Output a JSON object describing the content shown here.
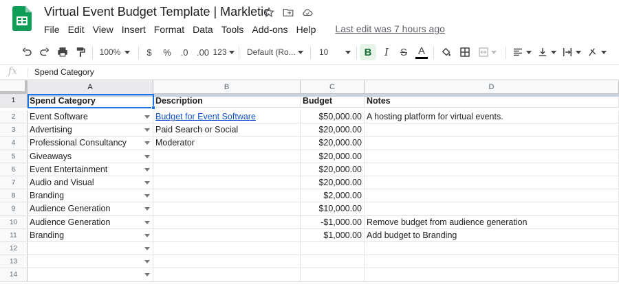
{
  "doc": {
    "title": "Virtual Event Budget Template | Markletic",
    "menus": [
      "File",
      "Edit",
      "View",
      "Insert",
      "Format",
      "Data",
      "Tools",
      "Add-ons",
      "Help"
    ],
    "last_edit": "Last edit was 7 hours ago"
  },
  "toolbar": {
    "zoom": "100%",
    "currency": "$",
    "percent": "%",
    "decrease_decimals": ".0",
    "increase_decimals": ".00",
    "more_formats": "123",
    "font": "Default (Ro...",
    "font_size": "10",
    "bold": "B",
    "italic": "I",
    "strike": "S",
    "text_color": "A"
  },
  "formula_bar": {
    "fx_label": "fx",
    "value": "Spend Category"
  },
  "columns": [
    "A",
    "B",
    "C",
    "D"
  ],
  "header_row": {
    "spend_category": "Spend Category",
    "description": "Description",
    "budget": "Budget",
    "notes": "Notes"
  },
  "rows": [
    {
      "num": "1"
    },
    {
      "num": "2",
      "category": "Event Software",
      "description": "Budget for Event Software",
      "budget": "$50,000.00",
      "notes": "A hosting platform for virtual events."
    },
    {
      "num": "3",
      "category": "Advertising",
      "description": "Paid Search or Social",
      "budget": "$20,000.00",
      "notes": ""
    },
    {
      "num": "4",
      "category": "Professional Consultancy",
      "description": "Moderator",
      "budget": "$20,000.00",
      "notes": ""
    },
    {
      "num": "5",
      "category": "Giveaways",
      "description": "",
      "budget": "$20,000.00",
      "notes": ""
    },
    {
      "num": "6",
      "category": "Event Entertainment",
      "description": "",
      "budget": "$20,000.00",
      "notes": ""
    },
    {
      "num": "7",
      "category": "Audio and Visual",
      "description": "",
      "budget": "$20,000.00",
      "notes": ""
    },
    {
      "num": "8",
      "category": "Branding",
      "description": "",
      "budget": "$2,000.00",
      "notes": ""
    },
    {
      "num": "9",
      "category": "Audience Generation",
      "description": "",
      "budget": "$10,000.00",
      "notes": ""
    },
    {
      "num": "10",
      "category": "Audience Generation",
      "description": "",
      "budget": "-$1,000.00",
      "notes": "Remove budget from audience generation"
    },
    {
      "num": "11",
      "category": "Branding",
      "description": "",
      "budget": "$1,000.00",
      "notes": "Add budget to Branding"
    },
    {
      "num": "12",
      "category": "",
      "description": "",
      "budget": "",
      "notes": ""
    },
    {
      "num": "13",
      "category": "",
      "description": "",
      "budget": "",
      "notes": ""
    },
    {
      "num": "14",
      "category": "",
      "description": "",
      "budget": "",
      "notes": ""
    }
  ],
  "colors": {
    "accent": "#1a73e8",
    "sheets_green": "#0f9d58",
    "link": "#1155cc"
  }
}
